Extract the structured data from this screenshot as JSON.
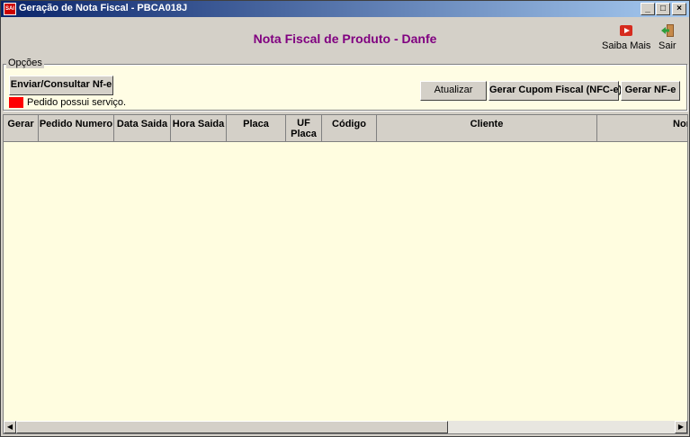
{
  "window": {
    "title": "Geração de Nota Fiscal - PBCA018J",
    "icon_text": "SAI",
    "minimize": "_",
    "maximize": "□",
    "close": "×"
  },
  "header": {
    "title": "Nota Fiscal de Produto - Danfe",
    "saiba_mais": "Saiba Mais",
    "sair": "Sair"
  },
  "opcoes": {
    "legend": "Opções",
    "enviar": "Enviar/Consultar Nf-e",
    "legend_text": "Pedido possui serviço.",
    "atualizar": "Atualizar",
    "gerar_cupom": "Gerar Cupom Fiscal (NFC-e)",
    "gerar_nfe": "Gerar NF-e"
  },
  "grid": {
    "columns": [
      "Gerar",
      "Pedido Numero",
      "Data Saida",
      "Hora Saida",
      "Placa",
      "UF Placa",
      "Código",
      "Cliente",
      "Nome"
    ]
  },
  "colors": {
    "title_purple": "#800080",
    "grid_bg": "#fffde0",
    "legend_red": "#ff0000"
  }
}
